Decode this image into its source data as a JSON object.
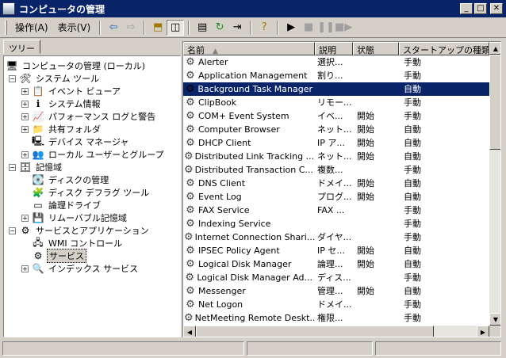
{
  "window": {
    "title": "コンピュータの管理"
  },
  "toolbar": {
    "menus": [
      "操作(A)",
      "表示(V)"
    ],
    "buttons": [
      "back",
      "forward",
      "up-folder",
      "show-hide-tree",
      "properties",
      "refresh",
      "export-list",
      "help",
      "start",
      "stop",
      "pause",
      "restart"
    ]
  },
  "tree_tab": "ツリー",
  "tree": [
    {
      "label": "コンピュータの管理 (ローカル)",
      "level": 0,
      "expander": "",
      "icon": "computer-icon",
      "glyph": "🖥"
    },
    {
      "label": "システム ツール",
      "level": 1,
      "expander": "−",
      "icon": "tools-icon",
      "glyph": "🛠"
    },
    {
      "label": "イベント ビューア",
      "level": 2,
      "expander": "+",
      "icon": "event-viewer-icon",
      "glyph": "📋"
    },
    {
      "label": "システム情報",
      "level": 2,
      "expander": "+",
      "icon": "system-info-icon",
      "glyph": "ℹ"
    },
    {
      "label": "パフォーマンス ログと警告",
      "level": 2,
      "expander": "+",
      "icon": "performance-icon",
      "glyph": "📈"
    },
    {
      "label": "共有フォルダ",
      "level": 2,
      "expander": "+",
      "icon": "shared-folder-icon",
      "glyph": "📁"
    },
    {
      "label": "デバイス マネージャ",
      "level": 2,
      "expander": "",
      "icon": "device-manager-icon",
      "glyph": "🖳"
    },
    {
      "label": "ローカル ユーザーとグループ",
      "level": 2,
      "expander": "+",
      "icon": "users-icon",
      "glyph": "👥"
    },
    {
      "label": "記憶域",
      "level": 1,
      "expander": "−",
      "icon": "storage-icon",
      "glyph": "🗄"
    },
    {
      "label": "ディスクの管理",
      "level": 2,
      "expander": "",
      "icon": "disk-management-icon",
      "glyph": "💽"
    },
    {
      "label": "ディスク デフラグ ツール",
      "level": 2,
      "expander": "",
      "icon": "defrag-icon",
      "glyph": "🧩"
    },
    {
      "label": "論理ドライブ",
      "level": 2,
      "expander": "",
      "icon": "logical-drive-icon",
      "glyph": "▭"
    },
    {
      "label": "リムーバブル記憶域",
      "level": 2,
      "expander": "+",
      "icon": "removable-storage-icon",
      "glyph": "💾"
    },
    {
      "label": "サービスとアプリケーション",
      "level": 1,
      "expander": "−",
      "icon": "services-apps-icon",
      "glyph": "⚙"
    },
    {
      "label": "WMI コントロール",
      "level": 2,
      "expander": "",
      "icon": "wmi-icon",
      "glyph": "🖧"
    },
    {
      "label": "サービス",
      "level": 2,
      "expander": "",
      "icon": "services-icon",
      "glyph": "⚙",
      "selected": true
    },
    {
      "label": "インデックス サービス",
      "level": 2,
      "expander": "+",
      "icon": "index-service-icon",
      "glyph": "🔍"
    }
  ],
  "list": {
    "columns": [
      "名前",
      "説明",
      "状態",
      "スタートアップの種類"
    ],
    "sort_indicator": "▲",
    "rows": [
      {
        "name": "Alerter",
        "desc": "選択...",
        "status": "",
        "startup": "手動"
      },
      {
        "name": "Application Management",
        "desc": "割り...",
        "status": "",
        "startup": "手動"
      },
      {
        "name": "Background Task Manager",
        "desc": "",
        "status": "",
        "startup": "自動",
        "selected": true
      },
      {
        "name": "ClipBook",
        "desc": "リモー...",
        "status": "",
        "startup": "手動"
      },
      {
        "name": "COM+ Event System",
        "desc": "イベ...",
        "status": "開始",
        "startup": "手動"
      },
      {
        "name": "Computer Browser",
        "desc": "ネット...",
        "status": "開始",
        "startup": "自動"
      },
      {
        "name": "DHCP Client",
        "desc": "IP ア...",
        "status": "開始",
        "startup": "自動"
      },
      {
        "name": "Distributed Link Tracking ...",
        "desc": "ネット...",
        "status": "開始",
        "startup": "自動"
      },
      {
        "name": "Distributed Transaction C...",
        "desc": "複数...",
        "status": "",
        "startup": "手動"
      },
      {
        "name": "DNS Client",
        "desc": "ドメイ...",
        "status": "開始",
        "startup": "自動"
      },
      {
        "name": "Event Log",
        "desc": "プログ...",
        "status": "開始",
        "startup": "自動"
      },
      {
        "name": "FAX Service",
        "desc": "FAX ...",
        "status": "",
        "startup": "手動"
      },
      {
        "name": "Indexing Service",
        "desc": "",
        "status": "",
        "startup": "手動"
      },
      {
        "name": "Internet Connection Shari...",
        "desc": "ダイヤ...",
        "status": "",
        "startup": "手動"
      },
      {
        "name": "IPSEC Policy Agent",
        "desc": "IP セ...",
        "status": "開始",
        "startup": "自動"
      },
      {
        "name": "Logical Disk Manager",
        "desc": "論理...",
        "status": "開始",
        "startup": "自動"
      },
      {
        "name": "Logical Disk Manager Ad...",
        "desc": "ディス...",
        "status": "",
        "startup": "手動"
      },
      {
        "name": "Messenger",
        "desc": "管理...",
        "status": "開始",
        "startup": "自動"
      },
      {
        "name": "Net Logon",
        "desc": "ドメイ...",
        "status": "",
        "startup": "手動"
      },
      {
        "name": "NetMeeting Remote Deskt...",
        "desc": "権限...",
        "status": "",
        "startup": "手動"
      }
    ]
  }
}
